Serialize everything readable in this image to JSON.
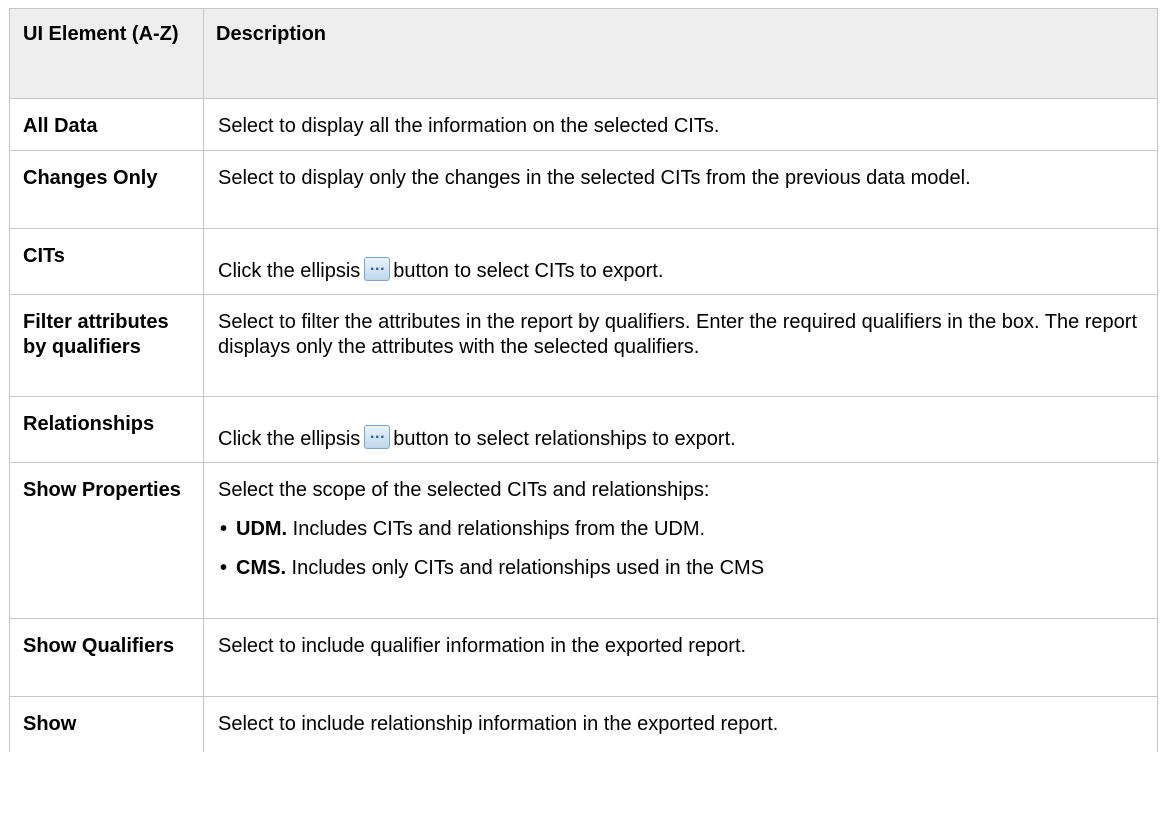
{
  "header": {
    "col_name": "UI Element (A-Z)",
    "col_desc": "Description"
  },
  "rows": [
    {
      "name": "All Data",
      "desc": "Select to display all the information on the selected CITs."
    },
    {
      "name": "Changes Only",
      "desc": "Select to display only the changes in the selected CITs from the previous data model."
    },
    {
      "name": "CITs",
      "desc_before": "Click the ellipsis",
      "icon": "ellipsis-button-icon",
      "desc_after": "button to select CITs to export."
    },
    {
      "name": "Filter attributes by qualifiers",
      "desc": "Select to filter the attributes in the report by qualifiers. Enter the required qualifiers in the box. The report displays only the attributes with the selected qualifiers."
    },
    {
      "name": "Relationships",
      "desc_before": "Click the ellipsis",
      "icon": "ellipsis-button-icon",
      "desc_after": "button to select relationships to export."
    },
    {
      "name": "Show Properties",
      "desc": "Select the scope of the selected CITs and relationships:",
      "bullets": [
        {
          "term": "UDM.",
          "text": " Includes CITs and relationships from the UDM."
        },
        {
          "term": "CMS.",
          "text": " Includes only CITs and relationships used in the CMS"
        }
      ]
    },
    {
      "name": "Show Qualifiers",
      "desc": "Select to include qualifier information in the exported report."
    },
    {
      "name": "Show",
      "desc": "Select to include relationship information in the exported report."
    }
  ]
}
